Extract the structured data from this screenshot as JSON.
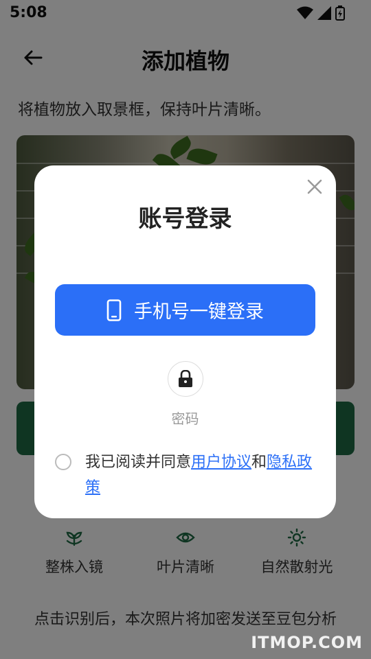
{
  "status_bar": {
    "time": "5:08"
  },
  "header": {
    "title": "添加植物"
  },
  "main": {
    "instruction": "将植物放入取景框，保持叶片清晰。",
    "tips": [
      {
        "icon": "sprout-icon",
        "label": "整株入镜"
      },
      {
        "icon": "eye-icon",
        "label": "叶片清晰"
      },
      {
        "icon": "sun-icon",
        "label": "自然散射光"
      }
    ],
    "footer_note": "点击识别后，本次照片将加密发送至豆包分析"
  },
  "login_dialog": {
    "title": "账号登录",
    "phone_login_label": "手机号一键登录",
    "password_login_label": "密码",
    "agreement": {
      "prefix": "我已阅读并同意",
      "user_agreement": "用户协议",
      "conjunction": "和",
      "privacy_policy": "隐私政策"
    }
  },
  "watermark": "ITMOP.COM",
  "colors": {
    "primary_blue": "#2b6ff7",
    "identify_green": "#1e6b45"
  }
}
